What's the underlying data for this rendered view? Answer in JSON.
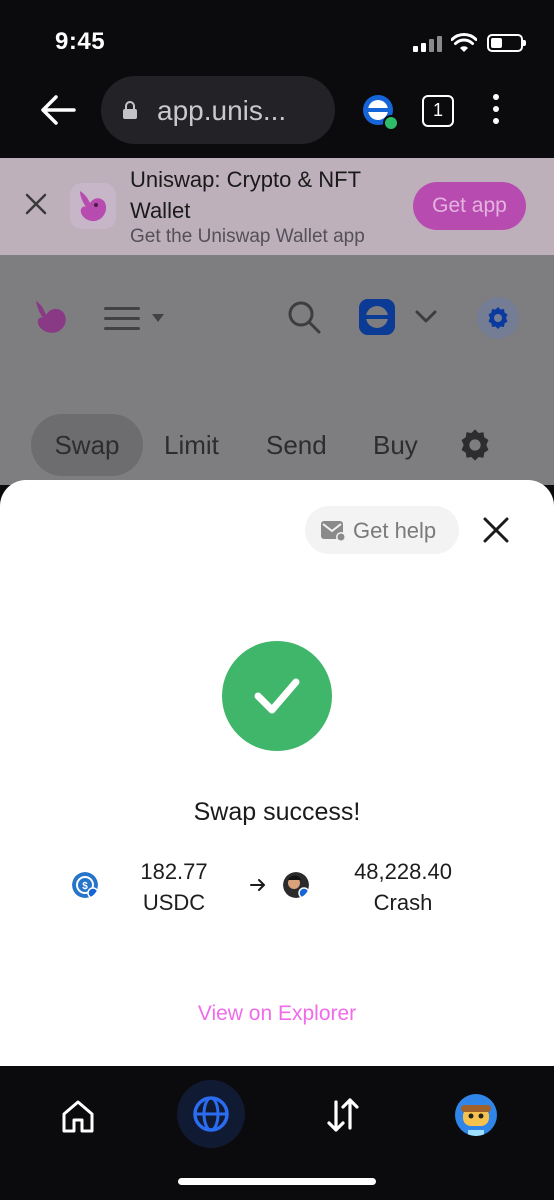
{
  "status_bar": {
    "time": "9:45"
  },
  "browser": {
    "url": "app.unis...",
    "tab_count": "1"
  },
  "banner": {
    "title": "Uniswap: Crypto & NFT Wallet",
    "subtitle": "Get the Uniswap Wallet app",
    "cta": "Get app"
  },
  "app": {
    "tabs": [
      "Swap",
      "Limit",
      "Send",
      "Buy"
    ]
  },
  "modal": {
    "help_label": "Get help",
    "success_title": "Swap success!",
    "from": {
      "amount": "182.77",
      "symbol": "USDC"
    },
    "to": {
      "amount": "48,228.40",
      "symbol": "Crash"
    },
    "explorer_link": "View on Explorer"
  },
  "colors": {
    "success": "#40b66b",
    "accent_pink": "#f06bea",
    "wallet_blue": "#1565d8"
  }
}
